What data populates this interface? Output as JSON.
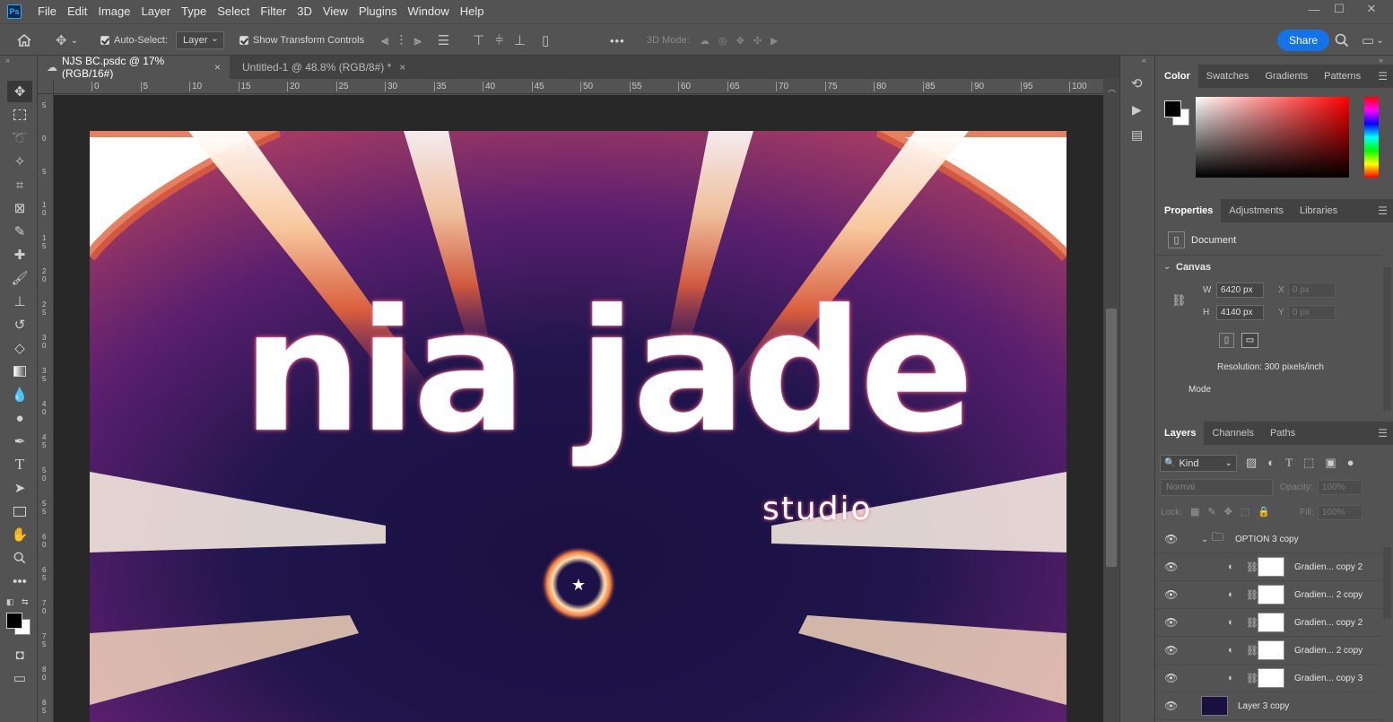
{
  "app": {
    "name": "Photoshop",
    "logo": "Ps"
  },
  "menu": [
    "File",
    "Edit",
    "Image",
    "Layer",
    "Type",
    "Select",
    "Filter",
    "3D",
    "View",
    "Plugins",
    "Window",
    "Help"
  ],
  "window_controls": {
    "minimize": "—",
    "maximize": "☐",
    "close": "✕"
  },
  "options_bar": {
    "auto_select_label": "Auto-Select:",
    "auto_select_value": "Layer",
    "transform_controls_label": "Show Transform Controls",
    "more_label": "•••",
    "mode_3d_label": "3D Mode:",
    "share_label": "Share"
  },
  "doc_tabs": [
    {
      "label": "NJS BC.psdc @ 17% (RGB/16#)",
      "close": "×",
      "active": true
    },
    {
      "label": "Untitled-1 @ 48.8% (RGB/8#) *",
      "close": "×",
      "active": false
    }
  ],
  "ruler_top_labels": [
    "0",
    "5",
    "10",
    "15",
    "20",
    "25",
    "30",
    "35",
    "40",
    "45",
    "50",
    "55",
    "60",
    "65",
    "70",
    "75",
    "80",
    "85",
    "90",
    "95",
    "100"
  ],
  "ruler_left_labels": [
    "5",
    "0",
    "5",
    "1 0",
    "1 5",
    "2 0",
    "2 5",
    "3 0",
    "3 5",
    "4 0",
    "4 5",
    "5 0",
    "5 5",
    "6 0",
    "6 5",
    "7 0",
    "7 5",
    "8 0",
    "8 5"
  ],
  "artwork": {
    "title": "nia jade",
    "subtitle": "studio"
  },
  "color_panel": {
    "tabs": [
      "Color",
      "Swatches",
      "Gradients",
      "Patterns"
    ],
    "foreground": "#000000",
    "background": "#ffffff",
    "hue_color": "#ff0000"
  },
  "properties_panel": {
    "tabs": [
      "Properties",
      "Adjustments",
      "Libraries"
    ],
    "doc_label": "Document",
    "section": "Canvas",
    "w_label": "W",
    "w_value": "6420 px",
    "h_label": "H",
    "h_value": "4140 px",
    "x_label": "X",
    "x_value": "0 px",
    "y_label": "Y",
    "y_value": "0 px",
    "resolution": "Resolution: 300 pixels/inch",
    "mode_label": "Mode"
  },
  "layers_panel": {
    "tabs": [
      "Layers",
      "Channels",
      "Paths"
    ],
    "filter_value": "Kind",
    "blend_mode": "Normal",
    "opacity_label": "Opacity:",
    "opacity_value": "100%",
    "lock_label": "Lock:",
    "fill_label": "Fill:",
    "fill_value": "100%",
    "group_name": "OPTION 3 copy",
    "layers": [
      {
        "name": "Gradien... copy 2"
      },
      {
        "name": "Gradien... 2 copy"
      },
      {
        "name": "Gradien... copy 2"
      },
      {
        "name": "Gradien... 2 copy"
      },
      {
        "name": "Gradien... copy 3"
      }
    ],
    "bottom_layer": "Layer 3 copy"
  }
}
